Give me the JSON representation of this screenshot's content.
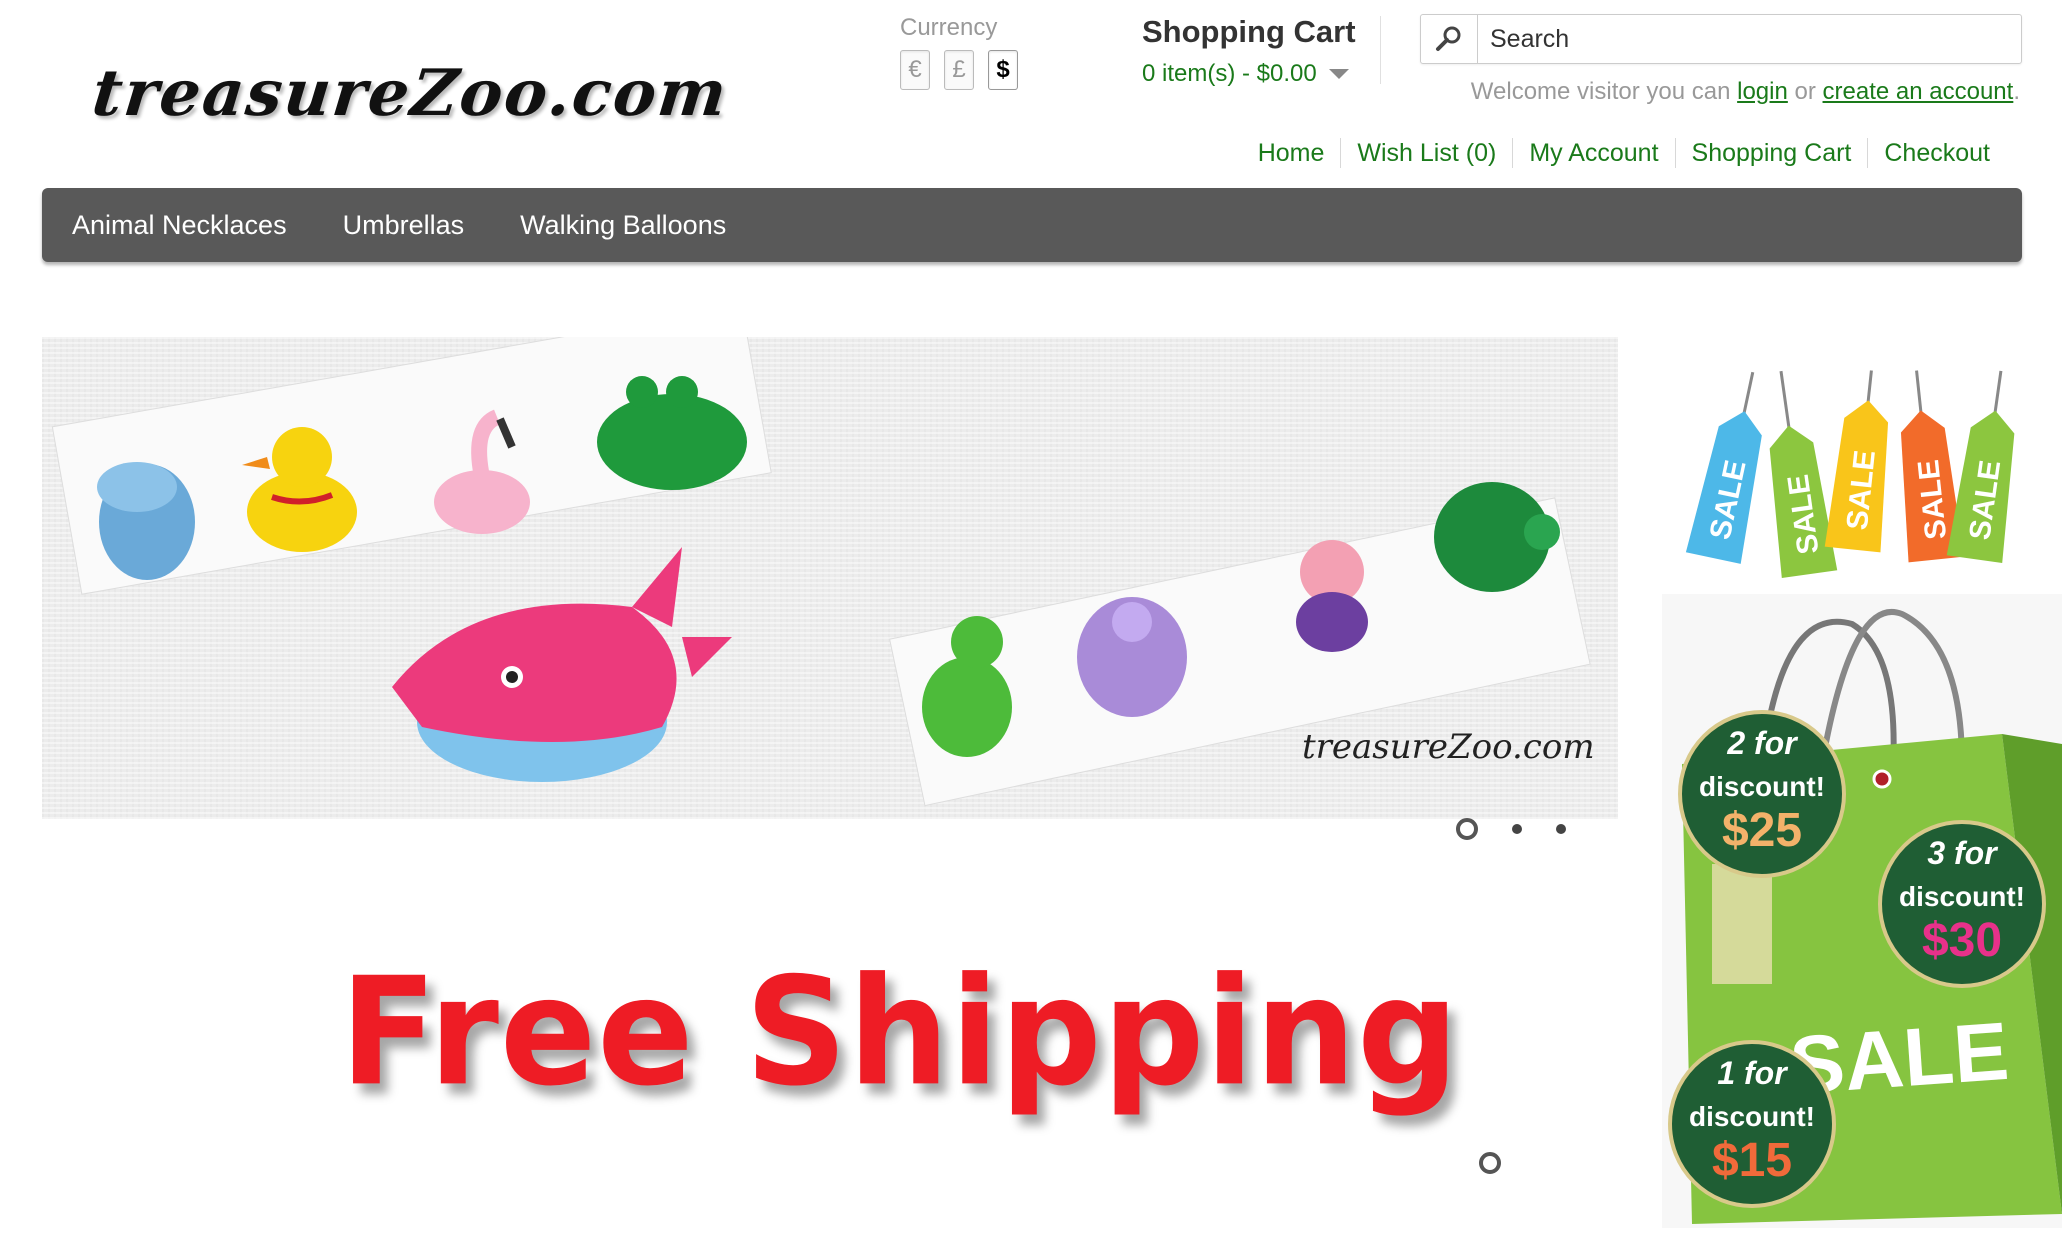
{
  "header": {
    "logo_text": "treasureZoo.com",
    "currency": {
      "label": "Currency",
      "options": [
        "€",
        "£",
        "$"
      ],
      "selected": "$"
    },
    "cart": {
      "title": "Shopping Cart",
      "summary": "0 item(s) - $0.00"
    },
    "search": {
      "placeholder": "Search"
    },
    "welcome": {
      "prefix": "Welcome visitor you can",
      "login": "login",
      "or": "or",
      "create_account": "create an account",
      "suffix": "."
    },
    "top_links": [
      "Home",
      "Wish List (0)",
      "My Account",
      "Shopping Cart",
      "Checkout"
    ]
  },
  "menu": [
    "Animal Necklaces",
    "Umbrellas",
    "Walking Balloons"
  ],
  "banner": {
    "caption": "treasureZoo.com",
    "slide_count": 3,
    "active_slide": 0
  },
  "promo": {
    "headline": "Free Shipping"
  },
  "sidebar": {
    "sale_tags": [
      "SALE",
      "SALE",
      "SALE",
      "SALE",
      "SALE"
    ],
    "sale_tag_colors": [
      "#4db8e8",
      "#8cc63f",
      "#f9c51a",
      "#f26b2a",
      "#8cc63f"
    ],
    "bag": {
      "word": "SALE",
      "deals": [
        {
          "qty": "2 for",
          "label": "discount!",
          "price": "$25"
        },
        {
          "qty": "3 for",
          "label": "discount!",
          "price": "$30"
        },
        {
          "qty": "1 for",
          "label": "discount!",
          "price": "$15"
        }
      ]
    }
  },
  "colors": {
    "link_green": "#1a7a1a",
    "menu_bg": "#595959",
    "free_shipping_red": "#ee1c25"
  }
}
